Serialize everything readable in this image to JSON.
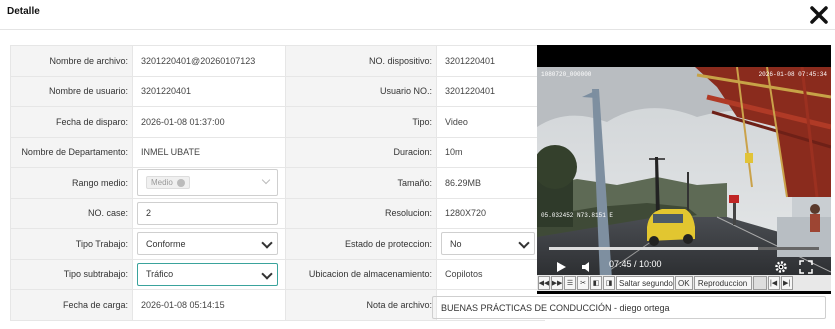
{
  "dialog": {
    "title": "Detalle",
    "close_icon": "close-icon"
  },
  "fields": {
    "nombre_archivo": {
      "label": "Nombre de archivo:",
      "value": "3201220401@20260107123"
    },
    "no_dispositivo": {
      "label": "NO. dispositivo:",
      "value": "3201220401"
    },
    "nombre_usuario": {
      "label": "Nombre de usuario:",
      "value": "3201220401"
    },
    "usuario_no": {
      "label": "Usuario NO.:",
      "value": "3201220401"
    },
    "fecha_disparo": {
      "label": "Fecha de disparo:",
      "value": "2026-01-08 01:37:00"
    },
    "tipo": {
      "label": "Tipo:",
      "value": "Video"
    },
    "departamento": {
      "label": "Nombre de Departamento:",
      "value": "INMEL UBATE"
    },
    "duracion": {
      "label": "Duracion:",
      "value": "10m"
    },
    "rango_medio": {
      "label": "Rango medio:",
      "chip": "Medio"
    },
    "tamano": {
      "label": "Tamaño:",
      "value": "86.29MB"
    },
    "no_case": {
      "label": "NO. case:",
      "value": "2"
    },
    "resolucion": {
      "label": "Resolucion:",
      "value": "1280X720"
    },
    "tipo_trabajo": {
      "label": "Tipo Trabajo:",
      "value": "Conforme"
    },
    "estado_proteccion": {
      "label": "Estado de proteccion:",
      "value": "No"
    },
    "tipo_subtrabajo": {
      "label": "Tipo subtrabajo:",
      "value": "Tráfico"
    },
    "ubicacion": {
      "label": "Ubicacion de almacenamiento:",
      "value": "Copilotos"
    },
    "fecha_carga": {
      "label": "Fecha de carga:",
      "value": "2026-01-08 05:14:15"
    },
    "nota_archivo": {
      "label": "Nota de archivo:",
      "value": "BUENAS PRÁCTICAS DE CONDUCCIÓN - diego ortega"
    }
  },
  "video": {
    "time": "07:45 / 10:00",
    "progress": 0.775,
    "overlay_left": "1080720_000000",
    "overlay_right": "2026-01-08 07:45:34",
    "overlay_bottom": "05.032452 N73.8151 E"
  },
  "toolbar": {
    "saltar_placeholder": "Saltar segundo",
    "ok_label": "OK",
    "reproduccion_label": "Reproduccion"
  }
}
